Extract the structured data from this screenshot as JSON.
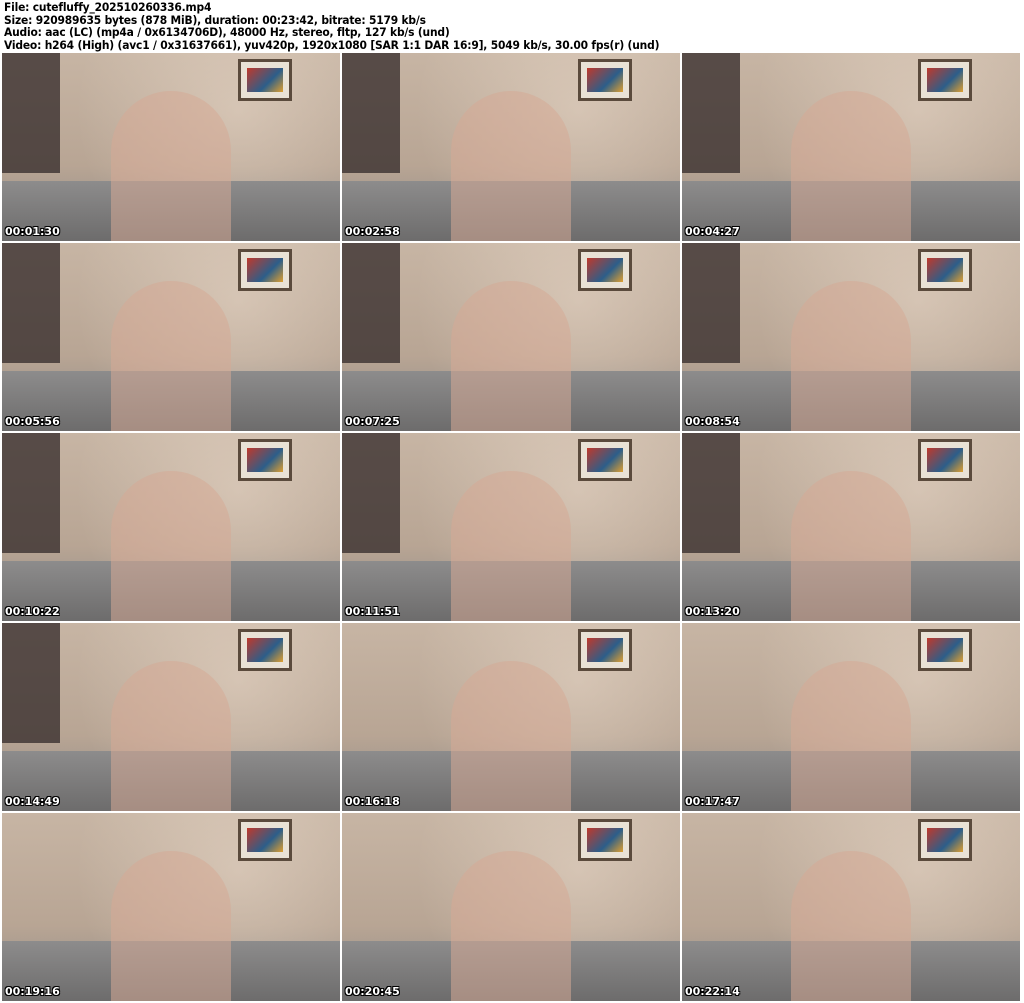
{
  "header": {
    "file": "File: cutefluffy_202510260336.mp4",
    "size": "Size: 920989635 bytes (878 MiB), duration: 00:23:42, bitrate: 5179 kb/s",
    "audio": "Audio: aac (LC) (mp4a / 0x6134706D), 48000 Hz, stereo, fltp, 127 kb/s (und)",
    "video": "Video: h264 (High) (avc1 / 0x31637661), yuv420p, 1920x1080 [SAR 1:1 DAR 16:9], 5049 kb/s, 30.00 fps(r) (und)"
  },
  "thumbnails": [
    {
      "timestamp": "00:01:30",
      "panel": true
    },
    {
      "timestamp": "00:02:58",
      "panel": true
    },
    {
      "timestamp": "00:04:27",
      "panel": true
    },
    {
      "timestamp": "00:05:56",
      "panel": true
    },
    {
      "timestamp": "00:07:25",
      "panel": true
    },
    {
      "timestamp": "00:08:54",
      "panel": true
    },
    {
      "timestamp": "00:10:22",
      "panel": true
    },
    {
      "timestamp": "00:11:51",
      "panel": true
    },
    {
      "timestamp": "00:13:20",
      "panel": true
    },
    {
      "timestamp": "00:14:49",
      "panel": true
    },
    {
      "timestamp": "00:16:18",
      "panel": false
    },
    {
      "timestamp": "00:17:47",
      "panel": false
    },
    {
      "timestamp": "00:19:16",
      "panel": false
    },
    {
      "timestamp": "00:20:45",
      "panel": false
    },
    {
      "timestamp": "00:22:14",
      "panel": false
    }
  ]
}
